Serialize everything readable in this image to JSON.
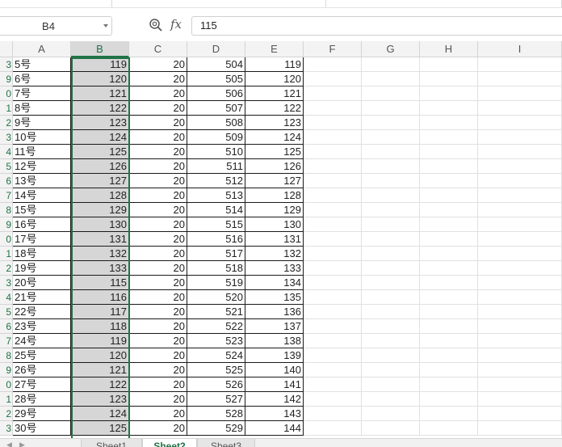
{
  "formula_bar": {
    "name_box": "B4",
    "fx_label": "fx",
    "formula_value": "115"
  },
  "columns": [
    "A",
    "B",
    "C",
    "D",
    "E",
    "F",
    "G",
    "H",
    "I"
  ],
  "selected_column": "B",
  "rows": [
    {
      "rownum": "3",
      "a": "5号",
      "b": "119",
      "c": "20",
      "d": "504",
      "e": "119"
    },
    {
      "rownum": "9",
      "a": "6号",
      "b": "120",
      "c": "20",
      "d": "505",
      "e": "120"
    },
    {
      "rownum": "0",
      "a": "7号",
      "b": "121",
      "c": "20",
      "d": "506",
      "e": "121"
    },
    {
      "rownum": "1",
      "a": "8号",
      "b": "122",
      "c": "20",
      "d": "507",
      "e": "122"
    },
    {
      "rownum": "2",
      "a": "9号",
      "b": "123",
      "c": "20",
      "d": "508",
      "e": "123"
    },
    {
      "rownum": "3",
      "a": "10号",
      "b": "124",
      "c": "20",
      "d": "509",
      "e": "124"
    },
    {
      "rownum": "4",
      "a": "11号",
      "b": "125",
      "c": "20",
      "d": "510",
      "e": "125"
    },
    {
      "rownum": "5",
      "a": "12号",
      "b": "126",
      "c": "20",
      "d": "511",
      "e": "126"
    },
    {
      "rownum": "6",
      "a": "13号",
      "b": "127",
      "c": "20",
      "d": "512",
      "e": "127"
    },
    {
      "rownum": "7",
      "a": "14号",
      "b": "128",
      "c": "20",
      "d": "513",
      "e": "128"
    },
    {
      "rownum": "8",
      "a": "15号",
      "b": "129",
      "c": "20",
      "d": "514",
      "e": "129"
    },
    {
      "rownum": "9",
      "a": "16号",
      "b": "130",
      "c": "20",
      "d": "515",
      "e": "130"
    },
    {
      "rownum": "0",
      "a": "17号",
      "b": "131",
      "c": "20",
      "d": "516",
      "e": "131"
    },
    {
      "rownum": "1",
      "a": "18号",
      "b": "132",
      "c": "20",
      "d": "517",
      "e": "132"
    },
    {
      "rownum": "2",
      "a": "19号",
      "b": "133",
      "c": "20",
      "d": "518",
      "e": "133"
    },
    {
      "rownum": "3",
      "a": "20号",
      "b": "115",
      "c": "20",
      "d": "519",
      "e": "134"
    },
    {
      "rownum": "4",
      "a": "21号",
      "b": "116",
      "c": "20",
      "d": "520",
      "e": "135"
    },
    {
      "rownum": "5",
      "a": "22号",
      "b": "117",
      "c": "20",
      "d": "521",
      "e": "136"
    },
    {
      "rownum": "6",
      "a": "23号",
      "b": "118",
      "c": "20",
      "d": "522",
      "e": "137"
    },
    {
      "rownum": "7",
      "a": "24号",
      "b": "119",
      "c": "20",
      "d": "523",
      "e": "138"
    },
    {
      "rownum": "8",
      "a": "25号",
      "b": "120",
      "c": "20",
      "d": "524",
      "e": "139"
    },
    {
      "rownum": "9",
      "a": "26号",
      "b": "121",
      "c": "20",
      "d": "525",
      "e": "140"
    },
    {
      "rownum": "0",
      "a": "27号",
      "b": "122",
      "c": "20",
      "d": "526",
      "e": "141"
    },
    {
      "rownum": "1",
      "a": "28号",
      "b": "123",
      "c": "20",
      "d": "527",
      "e": "142"
    },
    {
      "rownum": "2",
      "a": "29号",
      "b": "124",
      "c": "20",
      "d": "528",
      "e": "143"
    },
    {
      "rownum": "3",
      "a": "30号",
      "b": "125",
      "c": "20",
      "d": "529",
      "e": "144"
    }
  ],
  "sheet_tabs": [
    {
      "label": "Sheet1",
      "active": false
    },
    {
      "label": "Sheet2",
      "active": true
    },
    {
      "label": "Sheet3",
      "active": false
    }
  ],
  "colors": {
    "selection_accent": "#217346",
    "selected_column_fill": "#d6d6d6",
    "header_fill": "#f3f3f3"
  }
}
